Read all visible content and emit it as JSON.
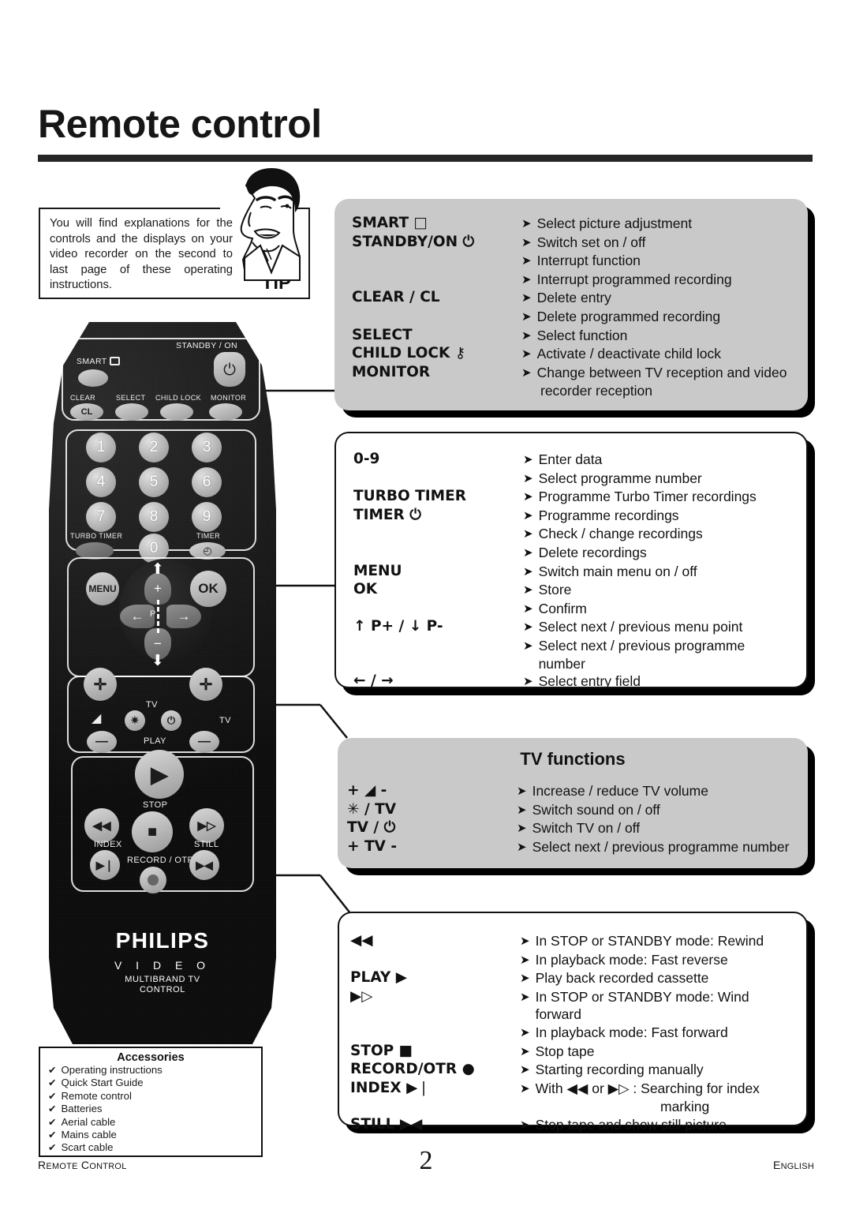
{
  "header": {
    "title": "Remote control"
  },
  "tip": {
    "text": "You will find explanations for the controls and the displays on your video recorder on the second to last page of these operating instructions.",
    "label": "TIP",
    "icon": "tip-face-icon"
  },
  "panels": [
    {
      "id": "panel-general",
      "style": "gray",
      "title": "",
      "rows": [
        {
          "key": "SMART □",
          "desc": "Select picture adjustment",
          "arrow": true
        },
        {
          "key": "STANDBY/ON ⏻",
          "desc": "Switch set on / off",
          "arrow": true
        },
        {
          "key": "",
          "desc": "Interrupt function",
          "arrow": true
        },
        {
          "key": "",
          "desc": "Interrupt programmed recording",
          "arrow": true
        },
        {
          "key": "CLEAR / CL",
          "desc": "Delete entry",
          "arrow": true
        },
        {
          "key": "",
          "desc": "Delete programmed recording",
          "arrow": true
        },
        {
          "key": "SELECT",
          "desc": "Select function",
          "arrow": true
        },
        {
          "key": "CHILD LOCK ⚷",
          "desc": "Activate / deactivate child lock",
          "arrow": true
        },
        {
          "key": "MONITOR",
          "desc": "Change between TV reception and video",
          "arrow": true
        },
        {
          "key": "",
          "desc": "recorder reception",
          "arrow": false
        }
      ]
    },
    {
      "id": "panel-menu",
      "style": "white",
      "title": "",
      "rows": [
        {
          "key": "0-9",
          "desc": "Enter data",
          "arrow": true
        },
        {
          "key": "",
          "desc": "Select programme number",
          "arrow": true
        },
        {
          "key": "TURBO TIMER",
          "desc": "Programme Turbo Timer recordings",
          "arrow": true
        },
        {
          "key": "TIMER ⏻",
          "desc": "Programme recordings",
          "arrow": true
        },
        {
          "key": "",
          "desc": "Check / change recordings",
          "arrow": true
        },
        {
          "key": "",
          "desc": "Delete recordings",
          "arrow": true
        },
        {
          "key": "MENU",
          "desc": "Switch main menu on / off",
          "arrow": true
        },
        {
          "key": "OK",
          "desc": "Store",
          "arrow": true
        },
        {
          "key": "",
          "desc": "Confirm",
          "arrow": true
        },
        {
          "key": "↑ P+ / ↓ P-",
          "desc": "Select next / previous menu point",
          "arrow": true
        },
        {
          "key": "",
          "desc": "Select next /  previous programme number",
          "arrow": true
        },
        {
          "key": "←  / →",
          "desc": "Select entry field",
          "arrow": true
        }
      ]
    },
    {
      "id": "panel-tv",
      "style": "gray",
      "title": "TV functions",
      "rows": [
        {
          "key": "+ ◢ -",
          "desc": "Increase / reduce TV volume",
          "arrow": true
        },
        {
          "key": "✳ / TV",
          "desc": "Switch sound on / off",
          "arrow": true
        },
        {
          "key": "TV / ⏻",
          "desc": "Switch TV on / off",
          "arrow": true
        },
        {
          "key": "+  TV  -",
          "desc": "Select next / previous programme number",
          "arrow": true
        }
      ]
    },
    {
      "id": "panel-transport",
      "style": "white",
      "title": "",
      "rows": [
        {
          "key": "◀◀",
          "desc": "In STOP  or STANDBY mode: Rewind",
          "arrow": true
        },
        {
          "key": "",
          "desc": "In playback mode: Fast reverse",
          "arrow": true
        },
        {
          "key": "PLAY ▶",
          "desc": "Play back recorded cassette",
          "arrow": true
        },
        {
          "key": "▶▷",
          "desc": "In STOP or STANDBY mode: Wind forward",
          "arrow": true
        },
        {
          "key": "",
          "desc": "In playback mode: Fast forward",
          "arrow": true
        },
        {
          "key": "STOP ■",
          "desc": "Stop tape",
          "arrow": true
        },
        {
          "key": "RECORD/OTR ●",
          "desc": "Starting recording manually",
          "arrow": true
        },
        {
          "key": "INDEX ▶❘",
          "desc": "With ◀◀ or ▶▷ :  Searching for index",
          "arrow": true
        },
        {
          "key": "",
          "desc": "marking",
          "arrow": false,
          "indent": true
        },
        {
          "key": "STILL ▶◀",
          "desc": "Stop tape and show still picture",
          "arrow": true
        }
      ]
    }
  ],
  "remote": {
    "top_zone": {
      "standby_label": "STANDBY / ON",
      "smart_label": "SMART",
      "buttons": [
        {
          "label": "CLEAR",
          "face": "CL"
        },
        {
          "label": "SELECT",
          "face": ""
        },
        {
          "label": "CHILD LOCK",
          "face": ""
        },
        {
          "label": "MONITOR",
          "face": ""
        }
      ]
    },
    "keypad": {
      "digits": [
        "1",
        "2",
        "3",
        "4",
        "5",
        "6",
        "7",
        "8",
        "9",
        "0"
      ],
      "turbo_timer_label": "TURBO TIMER",
      "timer_label": "TIMER"
    },
    "menu_zone": {
      "menu_label": "MENU",
      "ok_label": "OK",
      "p_label": "P"
    },
    "tv_zone": {
      "tv_label_center": "TV",
      "tv_label_right": "TV",
      "play_label": "PLAY"
    },
    "transport_zone": {
      "stop_label": "STOP",
      "index_label": "INDEX",
      "still_label": "STILL",
      "record_label": "RECORD / OTR"
    },
    "brand": {
      "name": "PHILIPS",
      "line1": "V I D E O",
      "line2": "MULTIBRAND TV",
      "line3": "CONTROL"
    }
  },
  "accessories": {
    "title": "Accessories",
    "check": "✔",
    "items": [
      "Operating instructions",
      "Quick Start Guide",
      "Remote control",
      "Batteries",
      "Aerial cable",
      "Mains cable",
      "Scart cable"
    ]
  },
  "footer": {
    "left": "Remote control",
    "page": "2",
    "right": "English"
  },
  "colors": {
    "panel_gray": "#c9c9c9",
    "ink": "#111111",
    "remote_body": "#101010"
  }
}
